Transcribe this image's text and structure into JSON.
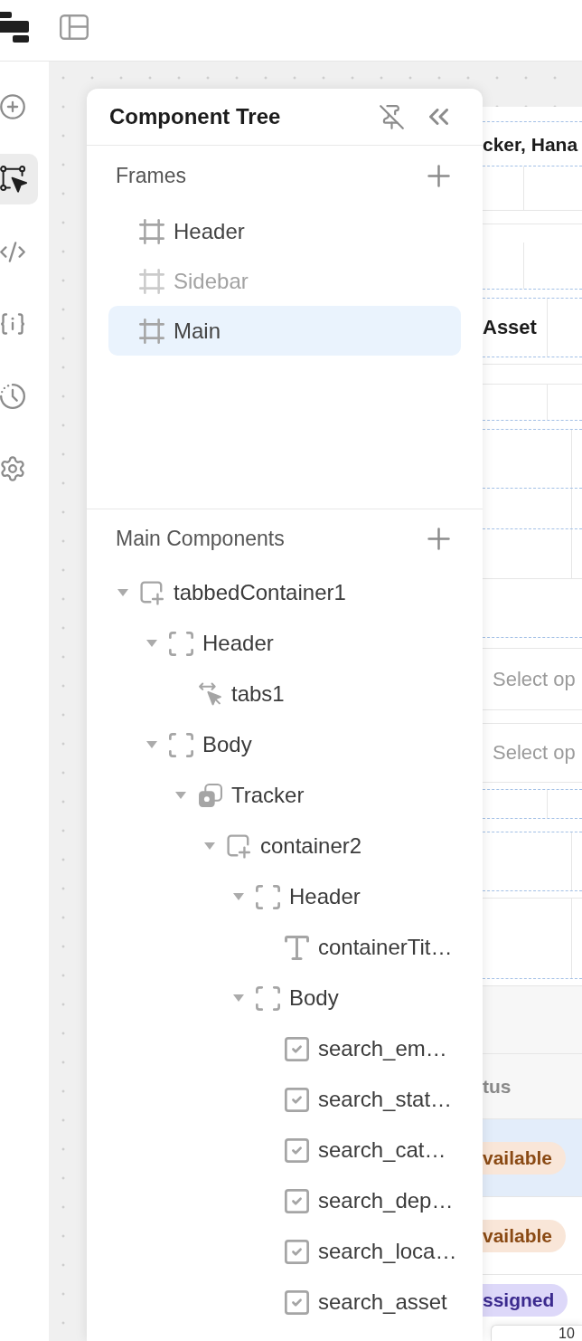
{
  "rail": [
    {
      "kind": "add",
      "selected": false
    },
    {
      "kind": "tree",
      "selected": true
    },
    {
      "kind": "code",
      "selected": false
    },
    {
      "kind": "variables",
      "selected": false
    },
    {
      "kind": "history",
      "selected": false
    },
    {
      "kind": "settings",
      "selected": false
    }
  ],
  "panel": {
    "title": "Component Tree",
    "frames": {
      "label": "Frames",
      "items": [
        {
          "label": "Header",
          "selected": false,
          "hidden": false
        },
        {
          "label": "Sidebar",
          "selected": false,
          "hidden": true
        },
        {
          "label": "Main",
          "selected": true,
          "hidden": false
        }
      ]
    },
    "components": {
      "label": "Main Components",
      "tree": [
        {
          "label": "tabbedContainer1",
          "kind": "container",
          "expanded": true,
          "children": [
            {
              "label": "Header",
              "kind": "section",
              "expanded": true,
              "children": [
                {
                  "label": "tabs1",
                  "kind": "tabs"
                }
              ]
            },
            {
              "label": "Body",
              "kind": "section",
              "expanded": true,
              "children": [
                {
                  "label": "Tracker",
                  "kind": "view",
                  "expanded": true,
                  "children": [
                    {
                      "label": "container2",
                      "kind": "container",
                      "expanded": true,
                      "children": [
                        {
                          "label": "Header",
                          "kind": "section",
                          "expanded": true,
                          "children": [
                            {
                              "label": "containerTit…",
                              "kind": "text"
                            }
                          ]
                        },
                        {
                          "label": "Body",
                          "kind": "section",
                          "expanded": true,
                          "children": [
                            {
                              "label": "search_em…",
                              "kind": "checkbox"
                            },
                            {
                              "label": "search_stat…",
                              "kind": "checkbox"
                            },
                            {
                              "label": "search_cat…",
                              "kind": "checkbox"
                            },
                            {
                              "label": "search_dep…",
                              "kind": "checkbox"
                            },
                            {
                              "label": "search_loca…",
                              "kind": "checkbox"
                            },
                            {
                              "label": "search_asset",
                              "kind": "checkbox"
                            }
                          ]
                        }
                      ]
                    }
                  ]
                }
              ]
            }
          ]
        }
      ]
    }
  },
  "preview": {
    "heading": "cker, Hana",
    "field_label": "Asset",
    "selects": [
      {
        "placeholder": "Select op"
      },
      {
        "placeholder": "Select op"
      }
    ],
    "table": {
      "column_header": "tus",
      "rows": [
        {
          "status": "vailable",
          "color": "#8a4a14",
          "selected": true
        },
        {
          "status": "vailable",
          "color": "#8a4a14",
          "selected": false
        },
        {
          "status": "ssigned",
          "color": "#3b2a8e",
          "selected": false
        }
      ]
    },
    "floating_field": {
      "value": "10"
    }
  }
}
